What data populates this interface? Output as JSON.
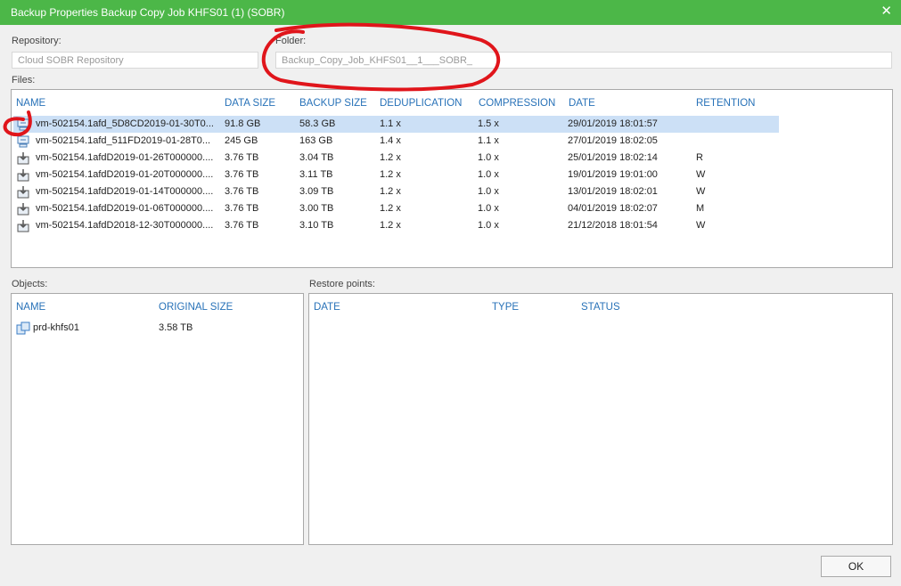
{
  "window": {
    "title": "Backup Properties Backup Copy Job KHFS01 (1) (SOBR)"
  },
  "repository": {
    "label": "Repository:",
    "value": "Cloud SOBR Repository"
  },
  "folder": {
    "label": "Folder:",
    "value": "Backup_Copy_Job_KHFS01__1___SOBR_"
  },
  "files": {
    "label": "Files:",
    "columns": [
      "NAME",
      "DATA SIZE",
      "BACKUP SIZE",
      "DEDUPLICATION",
      "COMPRESSION",
      "DATE",
      "RETENTION"
    ],
    "rows": [
      {
        "icon": "vm-file-icon",
        "name": "vm-502154.1afd_5D8CD2019-01-30T0...",
        "data_size": "91.8 GB",
        "backup_size": "58.3 GB",
        "dedup": "1.1 x",
        "compression": "1.5 x",
        "date": "29/01/2019 18:01:57",
        "retention": "",
        "selected": true
      },
      {
        "icon": "vm-file-icon",
        "name": "vm-502154.1afd_511FD2019-01-28T0...",
        "data_size": "245 GB",
        "backup_size": "163 GB",
        "dedup": "1.4 x",
        "compression": "1.1 x",
        "date": "27/01/2019 18:02:05",
        "retention": ""
      },
      {
        "icon": "full-backup-icon",
        "name": "vm-502154.1afdD2019-01-26T000000....",
        "data_size": "3.76 TB",
        "backup_size": "3.04 TB",
        "dedup": "1.2 x",
        "compression": "1.0 x",
        "date": "25/01/2019 18:02:14",
        "retention": "R"
      },
      {
        "icon": "full-backup-icon",
        "name": "vm-502154.1afdD2019-01-20T000000....",
        "data_size": "3.76 TB",
        "backup_size": "3.11 TB",
        "dedup": "1.2 x",
        "compression": "1.0 x",
        "date": "19/01/2019 19:01:00",
        "retention": "W"
      },
      {
        "icon": "full-backup-icon",
        "name": "vm-502154.1afdD2019-01-14T000000....",
        "data_size": "3.76 TB",
        "backup_size": "3.09 TB",
        "dedup": "1.2 x",
        "compression": "1.0 x",
        "date": "13/01/2019 18:02:01",
        "retention": "W"
      },
      {
        "icon": "full-backup-icon",
        "name": "vm-502154.1afdD2019-01-06T000000....",
        "data_size": "3.76 TB",
        "backup_size": "3.00 TB",
        "dedup": "1.2 x",
        "compression": "1.0 x",
        "date": "04/01/2019 18:02:07",
        "retention": "M"
      },
      {
        "icon": "full-backup-icon",
        "name": "vm-502154.1afdD2018-12-30T000000....",
        "data_size": "3.76 TB",
        "backup_size": "3.10 TB",
        "dedup": "1.2 x",
        "compression": "1.0 x",
        "date": "21/12/2018 18:01:54",
        "retention": "W"
      }
    ]
  },
  "objects": {
    "label": "Objects:",
    "columns": [
      "NAME",
      "ORIGINAL SIZE"
    ],
    "rows": [
      {
        "icon": "vm-icon",
        "name": "prd-khfs01",
        "size": "3.58 TB"
      }
    ]
  },
  "restore_points": {
    "label": "Restore points:",
    "columns": [
      "DATE",
      "TYPE",
      "STATUS"
    ],
    "rows": []
  },
  "footer": {
    "ok_label": "OK"
  },
  "colors": {
    "title_bar": "#4cb748",
    "header_text": "#2872b8",
    "selection": "#cce0f6",
    "annotation": "#e0151b"
  }
}
